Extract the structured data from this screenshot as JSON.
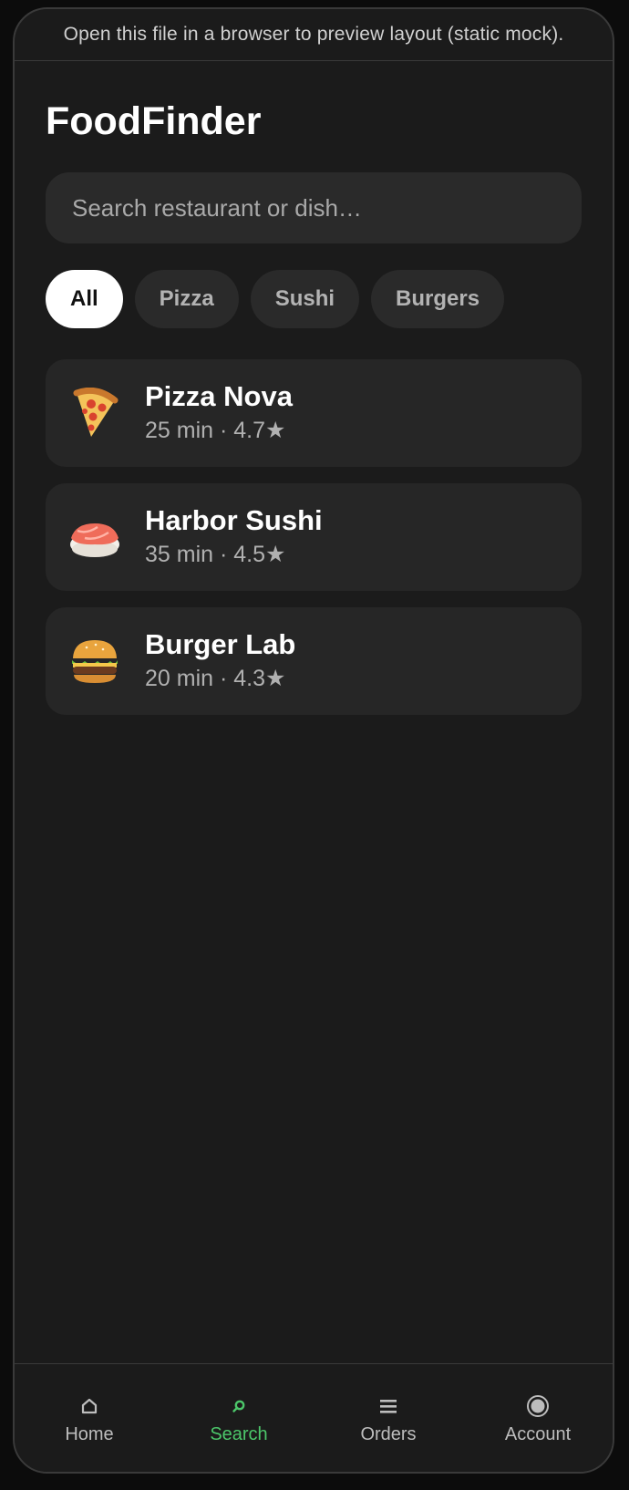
{
  "banner": "Open this file in a browser to preview layout (static mock).",
  "app_title": "FoodFinder",
  "search": {
    "placeholder": "Search restaurant or dish…",
    "icon": "search-icon"
  },
  "chips": [
    {
      "label": "All",
      "active": true
    },
    {
      "label": "Pizza",
      "active": false
    },
    {
      "label": "Sushi",
      "active": false
    },
    {
      "label": "Burgers",
      "active": false
    }
  ],
  "restaurants": [
    {
      "name": "Pizza Nova",
      "meta": "25 min · 4.7★",
      "icon": "pizza-icon"
    },
    {
      "name": "Harbor Sushi",
      "meta": "35 min · 4.5★",
      "icon": "sushi-icon"
    },
    {
      "name": "Burger Lab",
      "meta": "20 min · 4.3★",
      "icon": "burger-icon"
    }
  ],
  "tabs": [
    {
      "label": "Home",
      "icon": "home-icon",
      "active": false
    },
    {
      "label": "Search",
      "icon": "search-icon",
      "active": true
    },
    {
      "label": "Orders",
      "icon": "list-icon",
      "active": false
    },
    {
      "label": "Account",
      "icon": "account-icon",
      "active": false
    }
  ],
  "colors": {
    "background": "#1b1b1b",
    "card": "#262626",
    "accent": "#4cc66a",
    "chip_active": "#ffffff"
  }
}
